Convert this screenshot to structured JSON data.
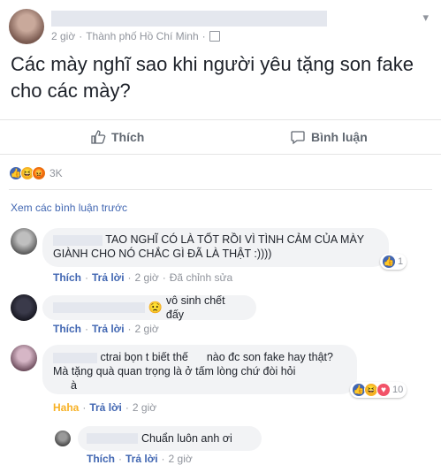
{
  "post": {
    "time": "2 giờ",
    "location": "Thành phố Hồ Chí Minh",
    "text": "Các mày nghĩ sao khi người yêu tặng son fake cho các mày?",
    "reaction_count": "3K"
  },
  "actions": {
    "like_label": "Thích",
    "comment_label": "Bình luận"
  },
  "view_previous": "Xem các bình luận trước",
  "comments": [
    {
      "text": "TAO NGHĨ CÓ LÀ TỐT RỒI VÌ TÌNH CẢM CỦA MÀY GIÀNH CHO NÓ CHẮC GÌ ĐÃ LÀ THẬT :))))",
      "like": "Thích",
      "reply": "Trả lời",
      "time": "2 giờ",
      "edited": "Đã chỉnh sửa",
      "reaction_count": "1"
    },
    {
      "text": "vô sinh chết đấy",
      "like": "Thích",
      "reply": "Trả lời",
      "time": "2 giờ"
    },
    {
      "text_part1": "ctrai bọn t biết thế",
      "text_part2": "nào đc son fake hay thật?",
      "text_line2": "Mà tặng quà quan trọng là ở tấm lòng chứ đòi hỏi",
      "text_line3": "à",
      "like": "Haha",
      "reply": "Trả lời",
      "time": "2 giờ",
      "reaction_count": "10"
    },
    {
      "text": "Chuẩn luôn anh ơi",
      "like": "Thích",
      "reply": "Trả lời",
      "time": "2 giờ"
    }
  ],
  "colors": {
    "link": "#4267b2",
    "meta": "#90949c",
    "bubble": "#f2f3f5",
    "haha": "#f7b125"
  }
}
